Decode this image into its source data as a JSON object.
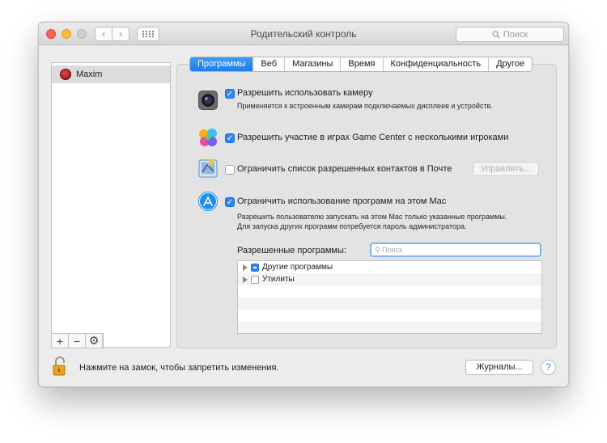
{
  "window": {
    "title": "Родительский контроль",
    "search_placeholder": "Поиск"
  },
  "sidebar": {
    "users": [
      {
        "name": "Maxim"
      }
    ],
    "add_label": "+",
    "remove_label": "−",
    "gear_label": "⚙"
  },
  "tabs": [
    {
      "label": "Программы",
      "active": true
    },
    {
      "label": "Веб",
      "active": false
    },
    {
      "label": "Магазины",
      "active": false
    },
    {
      "label": "Время",
      "active": false
    },
    {
      "label": "Конфиденциальность",
      "active": false
    },
    {
      "label": "Другое",
      "active": false
    }
  ],
  "options": {
    "camera": {
      "label": "Разрешить использовать камеру",
      "desc": "Применяется к встроенным камерам подключаемых дисплеев и устройств.",
      "checked": true
    },
    "gamecenter": {
      "label": "Разрешить участие в играх Game Center с несколькими игроками",
      "checked": true
    },
    "mail": {
      "label": "Ограничить список разрешенных контактов в Почте",
      "checked": false,
      "manage_label": "Управлять..."
    },
    "apps": {
      "label": "Ограничить использование программ на этом Mac",
      "desc_line1": "Разрешить пользователю запускать на этом Mac только указанные программы.",
      "desc_line2": "Для запуска других программ потребуется пароль администратора.",
      "checked": true
    }
  },
  "allowed": {
    "label": "Разрешенные программы:",
    "filter_placeholder": "Поиск",
    "items": [
      {
        "label": "Другие программы",
        "state": "mixed"
      },
      {
        "label": "Утилиты",
        "state": "off"
      }
    ]
  },
  "footer": {
    "lock_text": "Нажмите на замок, чтобы запретить изменения.",
    "journals_label": "Журналы...",
    "help_label": "?"
  },
  "colors": {
    "accent": "#2f86f2",
    "close": "#fc605b",
    "minimize": "#fdbc40"
  }
}
